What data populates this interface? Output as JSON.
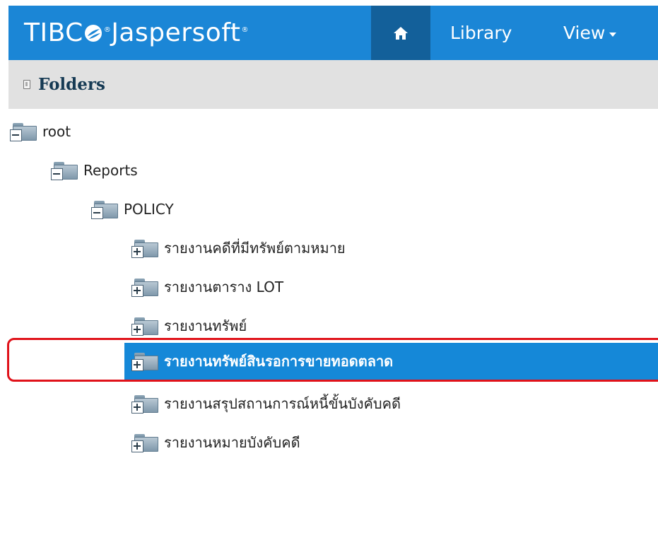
{
  "header": {
    "logo_text_left": "TIBC",
    "logo_text_right": "Jaspersoft",
    "nav": {
      "library_label": "Library",
      "view_label": "View"
    },
    "colors": {
      "bar": "#1b86d6",
      "home": "#13609a"
    }
  },
  "folders_panel": {
    "title": "Folders"
  },
  "tree": {
    "nodes": [
      {
        "label": "root",
        "expanded": true,
        "icon": "folder-collapse-icon"
      },
      {
        "label": "Reports",
        "expanded": true,
        "icon": "folder-collapse-icon"
      },
      {
        "label": "POLICY",
        "expanded": true,
        "icon": "folder-collapse-icon"
      },
      {
        "label": "รายงานคดีที่มีทรัพย์ตามหมาย",
        "expanded": false,
        "icon": "folder-expand-icon"
      },
      {
        "label": "รายงานตาราง LOT",
        "expanded": false,
        "icon": "folder-expand-icon"
      },
      {
        "label": "รายงานทรัพย์",
        "expanded": false,
        "icon": "folder-expand-icon"
      },
      {
        "label": "รายงานทรัพย์สินรอการขายทอดตลาด",
        "expanded": false,
        "selected": true,
        "icon": "folder-expand-icon"
      },
      {
        "label": "รายงานสรุปสถานการณ์หนี้ขั้นบังคับคดี",
        "expanded": false,
        "icon": "folder-expand-icon"
      },
      {
        "label": "รายงานหมายบังคับคดี",
        "expanded": false,
        "icon": "folder-expand-icon"
      }
    ],
    "selection_color": "#1588d8",
    "highlight_outline_color": "#e0121a"
  }
}
